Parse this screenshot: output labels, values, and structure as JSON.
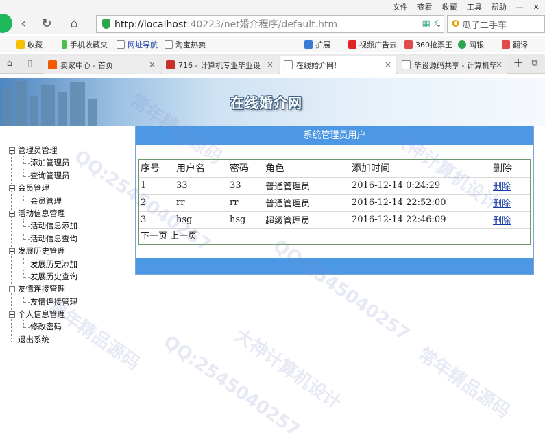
{
  "menubar": {
    "items": [
      "文件",
      "查看",
      "收藏",
      "工具",
      "帮助"
    ],
    "minimize": "—",
    "close": "✕"
  },
  "nav": {
    "url_host": "http://localhost",
    "url_rest": ":40223/net婚介程序/default.htm",
    "search_text": "瓜子二手车"
  },
  "bookmarks": [
    "收藏",
    "手机收藏夹",
    "网址导航",
    "淘宝热卖",
    "扩展",
    "视频广告去",
    "360抢票王",
    "网银",
    "翻译"
  ],
  "tabs": [
    {
      "label": "卖家中心 - 首页",
      "active": false
    },
    {
      "label": "716 - 计算机专业毕业设",
      "active": false
    },
    {
      "label": "在线婚介网!",
      "active": true
    },
    {
      "label": "毕设源码共享 - 计算机毕",
      "active": false
    }
  ],
  "site": {
    "title": "在线婚介网"
  },
  "sidebar": {
    "groups": [
      {
        "label": "管理员管理",
        "children": [
          "添加管理员",
          "查询管理员"
        ]
      },
      {
        "label": "会员管理",
        "children": [
          "会员管理"
        ]
      },
      {
        "label": "活动信息管理",
        "children": [
          "活动信息添加",
          "活动信息查询"
        ]
      },
      {
        "label": "发展历史管理",
        "children": [
          "发展历史添加",
          "发展历史查询"
        ]
      },
      {
        "label": "友情连接管理",
        "children": [
          "友情连接管理"
        ]
      },
      {
        "label": "个人信息管理",
        "children": [
          "修改密码"
        ]
      }
    ],
    "logout": "退出系统"
  },
  "panel": {
    "title": "系统管理员用户",
    "columns": [
      "序号",
      "用户名",
      "密码",
      "角色",
      "添加时间",
      "删除"
    ],
    "rows": [
      {
        "id": "1",
        "username": "33",
        "password": "33",
        "role": "普通管理员",
        "time": "2016-12-14 0:24:29",
        "delete": "删除"
      },
      {
        "id": "2",
        "username": "rr",
        "password": "rr",
        "role": "普通管理员",
        "time": "2016-12-14 22:52:00",
        "delete": "删除"
      },
      {
        "id": "3",
        "username": "hsg",
        "password": "hsg",
        "role": "超级管理员",
        "time": "2016-12-14 22:46:09",
        "delete": "删除"
      }
    ],
    "pager": {
      "next": "下一页",
      "prev": "上一页"
    }
  },
  "watermarks": [
    "QQ:2545040257",
    "大神计算机设计",
    "常年精品源码"
  ]
}
